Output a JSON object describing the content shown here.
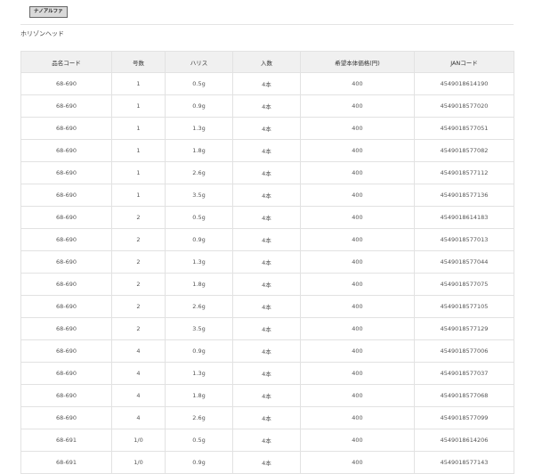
{
  "badge_label": "ナノアルファ",
  "section_title": "ホリゾンヘッド",
  "table": {
    "headers": [
      "品名コード",
      "号数",
      "ハリス",
      "入数",
      "希望本体価格(円)",
      "JANコード"
    ],
    "rows": [
      [
        "68-690",
        "1",
        "0.5g",
        "4本",
        "400",
        "4549018614190"
      ],
      [
        "68-690",
        "1",
        "0.9g",
        "4本",
        "400",
        "4549018577020"
      ],
      [
        "68-690",
        "1",
        "1.3g",
        "4本",
        "400",
        "4549018577051"
      ],
      [
        "68-690",
        "1",
        "1.8g",
        "4本",
        "400",
        "4549018577082"
      ],
      [
        "68-690",
        "1",
        "2.6g",
        "4本",
        "400",
        "4549018577112"
      ],
      [
        "68-690",
        "1",
        "3.5g",
        "4本",
        "400",
        "4549018577136"
      ],
      [
        "68-690",
        "2",
        "0.5g",
        "4本",
        "400",
        "4549018614183"
      ],
      [
        "68-690",
        "2",
        "0.9g",
        "4本",
        "400",
        "4549018577013"
      ],
      [
        "68-690",
        "2",
        "1.3g",
        "4本",
        "400",
        "4549018577044"
      ],
      [
        "68-690",
        "2",
        "1.8g",
        "4本",
        "400",
        "4549018577075"
      ],
      [
        "68-690",
        "2",
        "2.6g",
        "4本",
        "400",
        "4549018577105"
      ],
      [
        "68-690",
        "2",
        "3.5g",
        "4本",
        "400",
        "4549018577129"
      ],
      [
        "68-690",
        "4",
        "0.9g",
        "4本",
        "400",
        "4549018577006"
      ],
      [
        "68-690",
        "4",
        "1.3g",
        "4本",
        "400",
        "4549018577037"
      ],
      [
        "68-690",
        "4",
        "1.8g",
        "4本",
        "400",
        "4549018577068"
      ],
      [
        "68-690",
        "4",
        "2.6g",
        "4本",
        "400",
        "4549018577099"
      ],
      [
        "68-691",
        "1/0",
        "0.5g",
        "4本",
        "400",
        "4549018614206"
      ],
      [
        "68-691",
        "1/0",
        "0.9g",
        "4本",
        "400",
        "4549018577143"
      ]
    ]
  }
}
